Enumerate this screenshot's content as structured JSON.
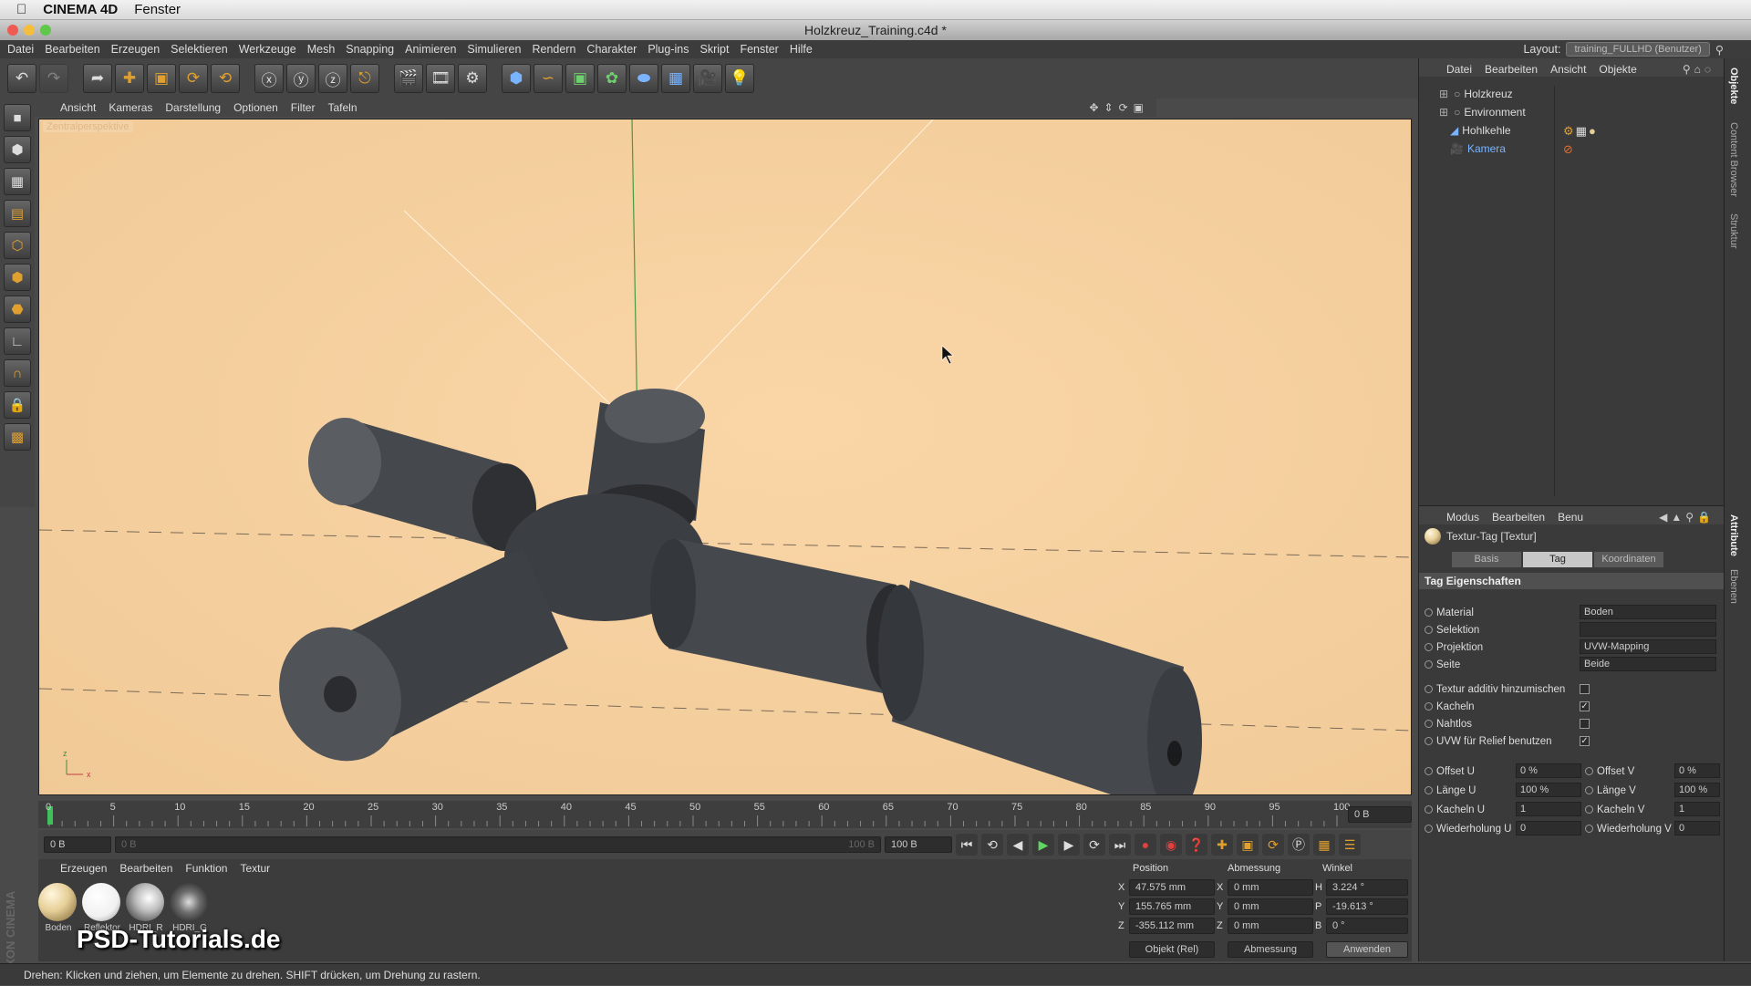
{
  "mac_menu": {
    "app": "CINEMA 4D",
    "items": [
      "Fenster"
    ]
  },
  "window_title": "Holzkreuz_Training.c4d *",
  "main_menu": [
    "Datei",
    "Bearbeiten",
    "Erzeugen",
    "Selektieren",
    "Werkzeuge",
    "Mesh",
    "Snapping",
    "Animieren",
    "Simulieren",
    "Rendern",
    "Charakter",
    "Plug-ins",
    "Skript",
    "Fenster",
    "Hilfe"
  ],
  "layout": {
    "label": "Layout:",
    "value": "training_FULLHD (Benutzer)"
  },
  "viewport": {
    "menu": [
      "Ansicht",
      "Kameras",
      "Darstellung",
      "Optionen",
      "Filter",
      "Tafeln"
    ],
    "label": "Zentralperspektive"
  },
  "timeline": {
    "ticks": [
      "0",
      "5",
      "10",
      "15",
      "20",
      "25",
      "30",
      "35",
      "40",
      "45",
      "50",
      "55",
      "60",
      "65",
      "70",
      "75",
      "80",
      "85",
      "90",
      "95",
      "100"
    ],
    "current_frame": "0 B",
    "start_field": "0 B",
    "range_start": "0 B",
    "range_end": "100 B",
    "end_field": "100 B"
  },
  "material_panel": {
    "menu": [
      "Erzeugen",
      "Bearbeiten",
      "Funktion",
      "Textur"
    ],
    "materials": [
      {
        "name": "Boden",
        "color": "#e6cf98"
      },
      {
        "name": "Reflektor",
        "color": "#ffffff"
      },
      {
        "name": "HDRI_R",
        "color": "#bdbdbd"
      },
      {
        "name": "HDRI_G",
        "color": "#6e6e6e"
      }
    ]
  },
  "coordinates": {
    "headers": [
      "Position",
      "Abmessung",
      "Winkel"
    ],
    "rows": [
      {
        "axis": "X",
        "pos": "47.575 mm",
        "size_axis": "X",
        "size": "0 mm",
        "angle_axis": "H",
        "angle": "3.224 °"
      },
      {
        "axis": "Y",
        "pos": "155.765 mm",
        "size_axis": "Y",
        "size": "0 mm",
        "angle_axis": "P",
        "angle": "-19.613 °"
      },
      {
        "axis": "Z",
        "pos": "-355.112 mm",
        "size_axis": "Z",
        "size": "0 mm",
        "angle_axis": "B",
        "angle": "0 °"
      }
    ],
    "mode": "Objekt (Rel)",
    "size_mode": "Abmessung",
    "apply": "Anwenden"
  },
  "object_manager": {
    "menu": [
      "Datei",
      "Bearbeiten",
      "Ansicht",
      "Objekte"
    ],
    "objects": [
      {
        "name": "Holzkreuz"
      },
      {
        "name": "Environment"
      },
      {
        "name": "Hohlkehle"
      },
      {
        "name": "Kamera"
      }
    ]
  },
  "attributes": {
    "menu": [
      "Modus",
      "Bearbeiten",
      "Benu"
    ],
    "title": "Textur-Tag [Textur]",
    "tabs": [
      "Basis",
      "Tag",
      "Koordinaten"
    ],
    "active_tab": "Tag",
    "section": "Tag Eigenschaften",
    "props": [
      {
        "label": "Material",
        "value": "Boden"
      },
      {
        "label": "Selektion",
        "value": ""
      },
      {
        "label": "Projektion",
        "value": "UVW-Mapping"
      },
      {
        "label": "Seite",
        "value": "Beide"
      }
    ],
    "checks": [
      {
        "label": "Textur additiv hinzumischen",
        "checked": false,
        "mark": ""
      },
      {
        "label": "Kacheln",
        "checked": true,
        "mark": "✓"
      },
      {
        "label": "Nahtlos",
        "checked": false,
        "mark": ""
      },
      {
        "label": "UVW für Relief benutzen",
        "checked": true,
        "mark": "✓"
      }
    ],
    "numeric": [
      {
        "l1": "Offset U",
        "v1": "0 %",
        "l2": "Offset V",
        "v2": "0 %"
      },
      {
        "l1": "Länge U",
        "v1": "100 %",
        "l2": "Länge V",
        "v2": "100 %"
      },
      {
        "l1": "Kacheln U",
        "v1": "1",
        "l2": "Kacheln V",
        "v2": "1"
      },
      {
        "l1": "Wiederholung U",
        "v1": "0",
        "l2": "Wiederholung V",
        "v2": "0"
      }
    ]
  },
  "right_tabs": [
    "Objekte",
    "Content Browser",
    "Struktur",
    "Attribute",
    "Ebenen"
  ],
  "status": "Drehen: Klicken und ziehen, um Elemente zu drehen. SHIFT drücken, um Drehung zu rastern.",
  "watermark": "PSD-Tutorials.de",
  "side_logo": "MAXON CINEMA 4D",
  "colors": {
    "viewport_bg": "#f6d1a0",
    "model": "#4a4d52",
    "accent_red": "#d03030",
    "accent_orange": "#e0a030"
  }
}
